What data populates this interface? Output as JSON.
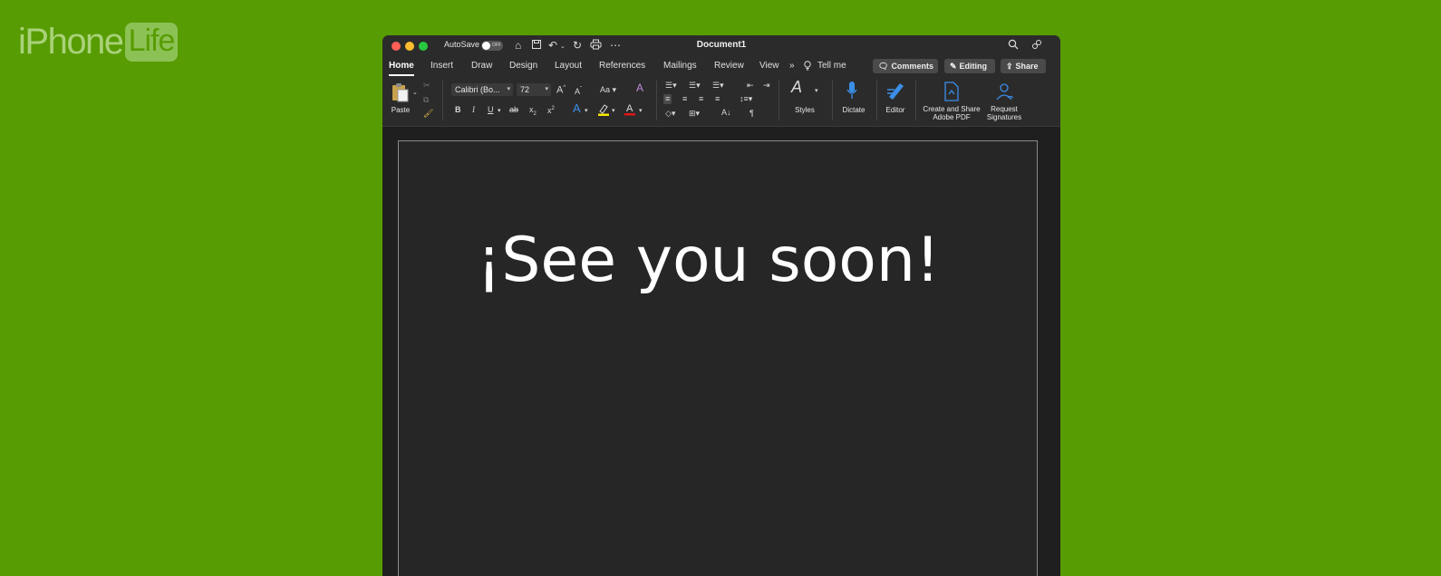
{
  "logo": {
    "part1": "iPhone",
    "part2": "Life"
  },
  "titlebar": {
    "autosave_label": "AutoSave",
    "autosave_state": "OFF",
    "document_title": "Document1"
  },
  "tabs": [
    {
      "label": "Home",
      "active": true
    },
    {
      "label": "Insert"
    },
    {
      "label": "Draw"
    },
    {
      "label": "Design"
    },
    {
      "label": "Layout"
    },
    {
      "label": "References"
    },
    {
      "label": "Mailings"
    },
    {
      "label": "Review"
    },
    {
      "label": "View"
    }
  ],
  "tellme": "Tell me",
  "buttons": {
    "comments": "Comments",
    "editing": "Editing",
    "share": "Share"
  },
  "ribbon": {
    "paste": "Paste",
    "font_name": "Calibri (Bo...",
    "font_size": "72",
    "styles": "Styles",
    "dictate": "Dictate",
    "editor": "Editor",
    "create_share_line1": "Create and Share",
    "create_share_line2": "Adobe PDF",
    "request_line1": "Request",
    "request_line2": "Signatures"
  },
  "document": {
    "text": "¡See you soon!"
  },
  "colors": {
    "background": "#579c02",
    "highlight": "#f7e900",
    "font_color": "#e0171a",
    "accent_blue": "#3b8ee8"
  }
}
